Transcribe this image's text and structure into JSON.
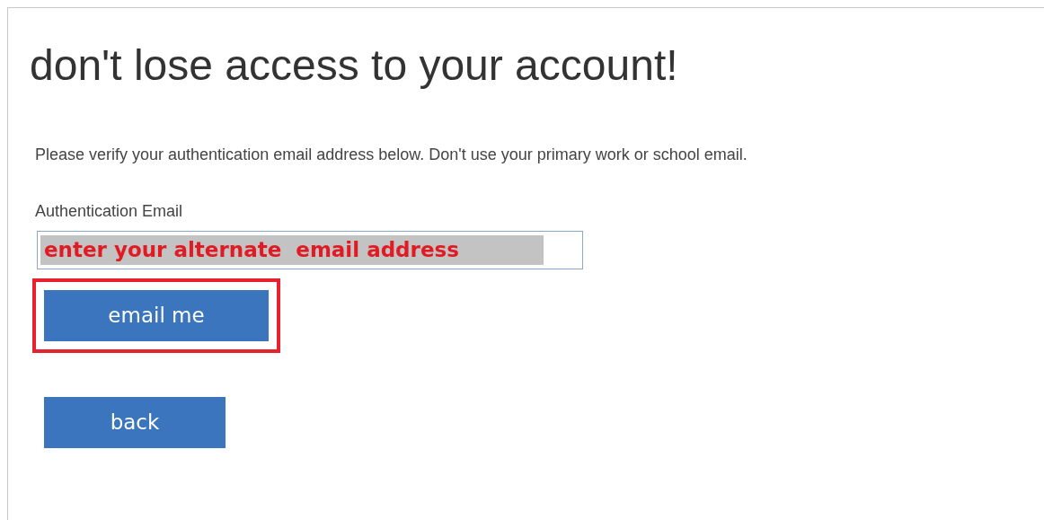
{
  "heading": "don't lose access to your account!",
  "instruction": "Please verify your authentication email address below. Don't use your primary work or school email.",
  "field": {
    "label": "Authentication Email",
    "value": "enter your alternate  email address",
    "highlighted": true
  },
  "buttons": [
    {
      "label": "email me",
      "highlighted": true
    },
    {
      "label": "back",
      "highlighted": false
    }
  ]
}
